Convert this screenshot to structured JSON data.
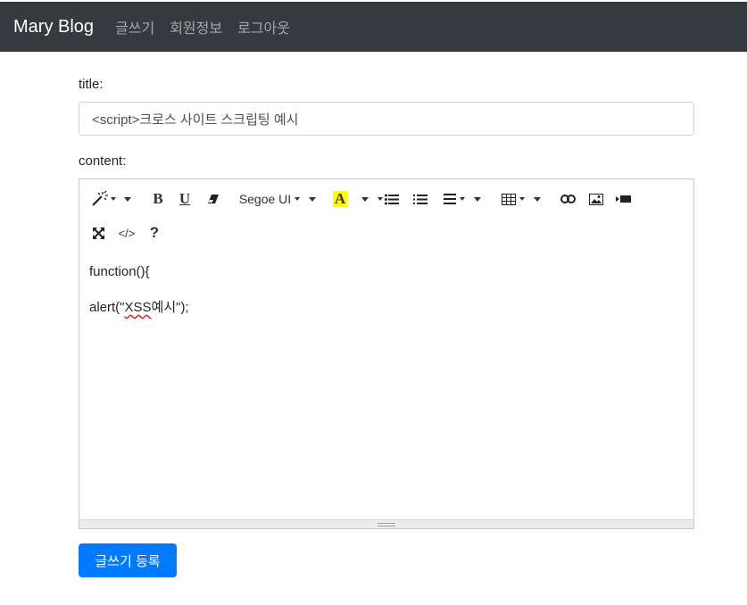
{
  "navbar": {
    "brand": "Mary Blog",
    "links": [
      "글쓰기",
      "회원정보",
      "로그아웃"
    ],
    "background": "#343a40"
  },
  "form": {
    "title_label": "title:",
    "title_value": "<script>크로스 사이트 스크립팅 예시",
    "content_label": "content:",
    "content_lines": [
      "function(){",
      "alert(\"XSS예시\");"
    ],
    "submit_label": "글쓰기 등록",
    "submit_color": "#007bff"
  },
  "toolbar": {
    "font_name": "Segoe UI",
    "icons": [
      "magic-icon",
      "bold-icon",
      "underline-icon",
      "eraser-icon",
      "font-name-dropdown",
      "font-color-icon",
      "unordered-list-icon",
      "ordered-list-icon",
      "paragraph-align-icon",
      "table-icon",
      "link-icon",
      "picture-icon",
      "video-icon",
      "fullscreen-icon",
      "code-view-icon",
      "help-icon"
    ]
  }
}
